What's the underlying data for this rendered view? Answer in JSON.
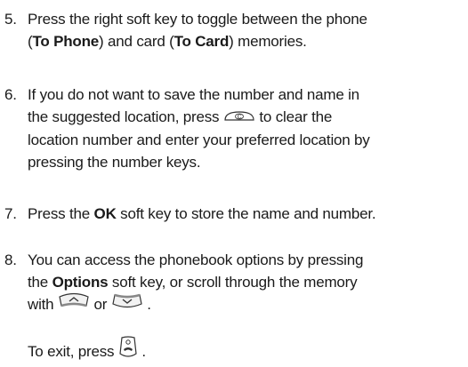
{
  "steps": [
    {
      "number": "5.",
      "line1_a": "Press the right soft key to toggle between the phone",
      "line2_open1": "(",
      "line2_bold1": "To Phone",
      "line2_mid": ") and card (",
      "line2_bold2": "To Card",
      "line2_end": ") memories."
    },
    {
      "number": "6.",
      "line1": "If you do not want to save the number and name in",
      "line2_a": "the suggested location, press",
      "line2_b": "to clear the",
      "line3": "location number and enter your preferred location by",
      "line4": "pressing the number keys.",
      "clear_key_icon": "c-key-icon"
    },
    {
      "number": "7.",
      "text_a": "Press the ",
      "bold": "OK",
      "text_b": " soft key to store the name and number."
    },
    {
      "number": "8.",
      "line1": "You can access the phonebook options by pressing",
      "line2_a": "the ",
      "line2_bold": "Options",
      "line2_b": " soft key, or scroll through the memory",
      "line3_a": "with",
      "line3_or": "or",
      "line3_end": ".",
      "up_key_icon": "up-key-icon",
      "down_key_icon": "down-key-icon"
    }
  ],
  "exit_note": {
    "text": "To exit, press",
    "end": ".",
    "end_key_icon": "end-call-key-icon"
  }
}
